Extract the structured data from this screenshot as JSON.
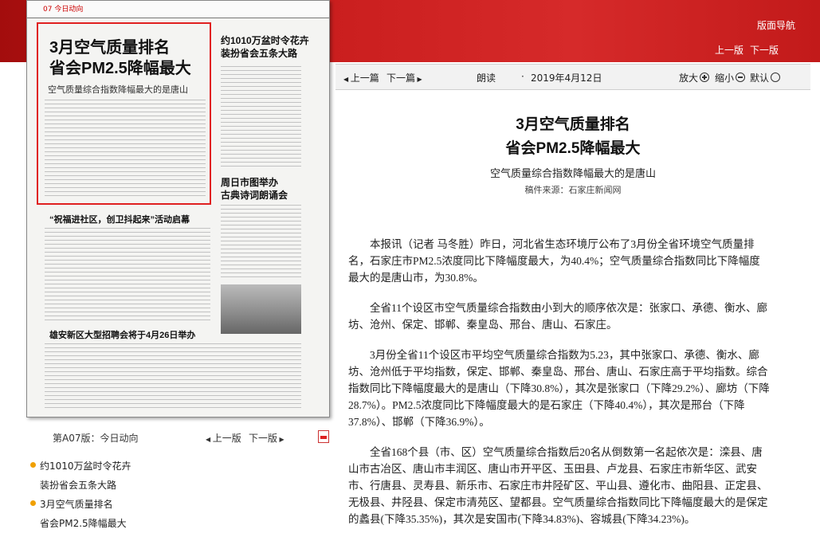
{
  "header": {
    "nav_title": "版面导航",
    "prev_page": "上一版",
    "next_page": "下一版"
  },
  "toolbar": {
    "prev_article": "上一篇",
    "next_article": "下一篇",
    "read_aloud": "朗读",
    "date": "2019年4月12日",
    "zoom_in": "放大",
    "zoom_out": "缩小",
    "default": "默认"
  },
  "paper_thumb": {
    "page_label": "07 今日动向",
    "headline": "3月空气质量排名 省会PM2.5降幅最大",
    "headline_line1": "3月空气质量排名",
    "headline_line2": "省会PM2.5降幅最大",
    "subheadline": "空气质量综合指数降幅最大的是唐山",
    "h_right1_line1": "约1010万盆时令花卉",
    "h_right1_line2": "装扮省会五条大路",
    "h_mid": "“祝福进社区，创卫抖起来”活动启幕",
    "h_right2_line1": "周日市图举办",
    "h_right2_line2": "古典诗词朗诵会",
    "h_bottom": "雄安新区大型招聘会将于4月26日举办"
  },
  "left_nav": {
    "page_name": "第A07版：今日动向",
    "prev": "上一版",
    "next": "下一版",
    "items": [
      {
        "line1": "约1010万盆时令花卉",
        "line2": "装扮省会五条大路"
      },
      {
        "line1": "3月空气质量排名",
        "line2": "省会PM2.5降幅最大"
      }
    ]
  },
  "article": {
    "title_line1": "3月空气质量排名",
    "title_line2": "省会PM2.5降幅最大",
    "subtitle": "空气质量综合指数降幅最大的是唐山",
    "source": "稿件来源：石家庄新闻网",
    "paragraphs": [
      "本报讯（记者 马冬胜）昨日，河北省生态环境厅公布了3月份全省环境空气质量排名，石家庄市PM2.5浓度同比下降幅度最大，为40.4%；空气质量综合指数同比下降幅度最大的是唐山市，为30.8%。",
      "全省11个设区市空气质量综合指数由小到大的顺序依次是：张家口、承德、衡水、廊坊、沧州、保定、邯郸、秦皇岛、邢台、唐山、石家庄。",
      "3月份全省11个设区市平均空气质量综合指数为5.23，其中张家口、承德、衡水、廊坊、沧州低于平均指数，保定、邯郸、秦皇岛、邢台、唐山、石家庄高于平均指数。综合指数同比下降幅度最大的是唐山（下降30.8%），其次是张家口（下降29.2%）、廊坊（下降28.7%）。PM2.5浓度同比下降幅度最大的是石家庄（下降40.4%），其次是邢台（下降37.8%）、邯郸（下降36.9%）。",
      "全省168个县（市、区）空气质量综合指数后20名从倒数第一名起依次是：滦县、唐山市古冶区、唐山市丰润区、唐山市开平区、玉田县、卢龙县、石家庄市新华区、武安市、行唐县、灵寿县、新乐市、石家庄市井陉矿区、平山县、遵化市、曲阳县、正定县、无极县、井陉县、保定市清苑区、望都县。空气质量综合指数同比下降幅度最大的是保定的蠡县(下降35.35%)，其次是安国市(下降34.83%)、容城县(下降34.23%)。"
    ]
  },
  "colors": {
    "brand_red": "#c81c1c",
    "highlight_box": "#e02020",
    "bullet": "#f0a000"
  }
}
